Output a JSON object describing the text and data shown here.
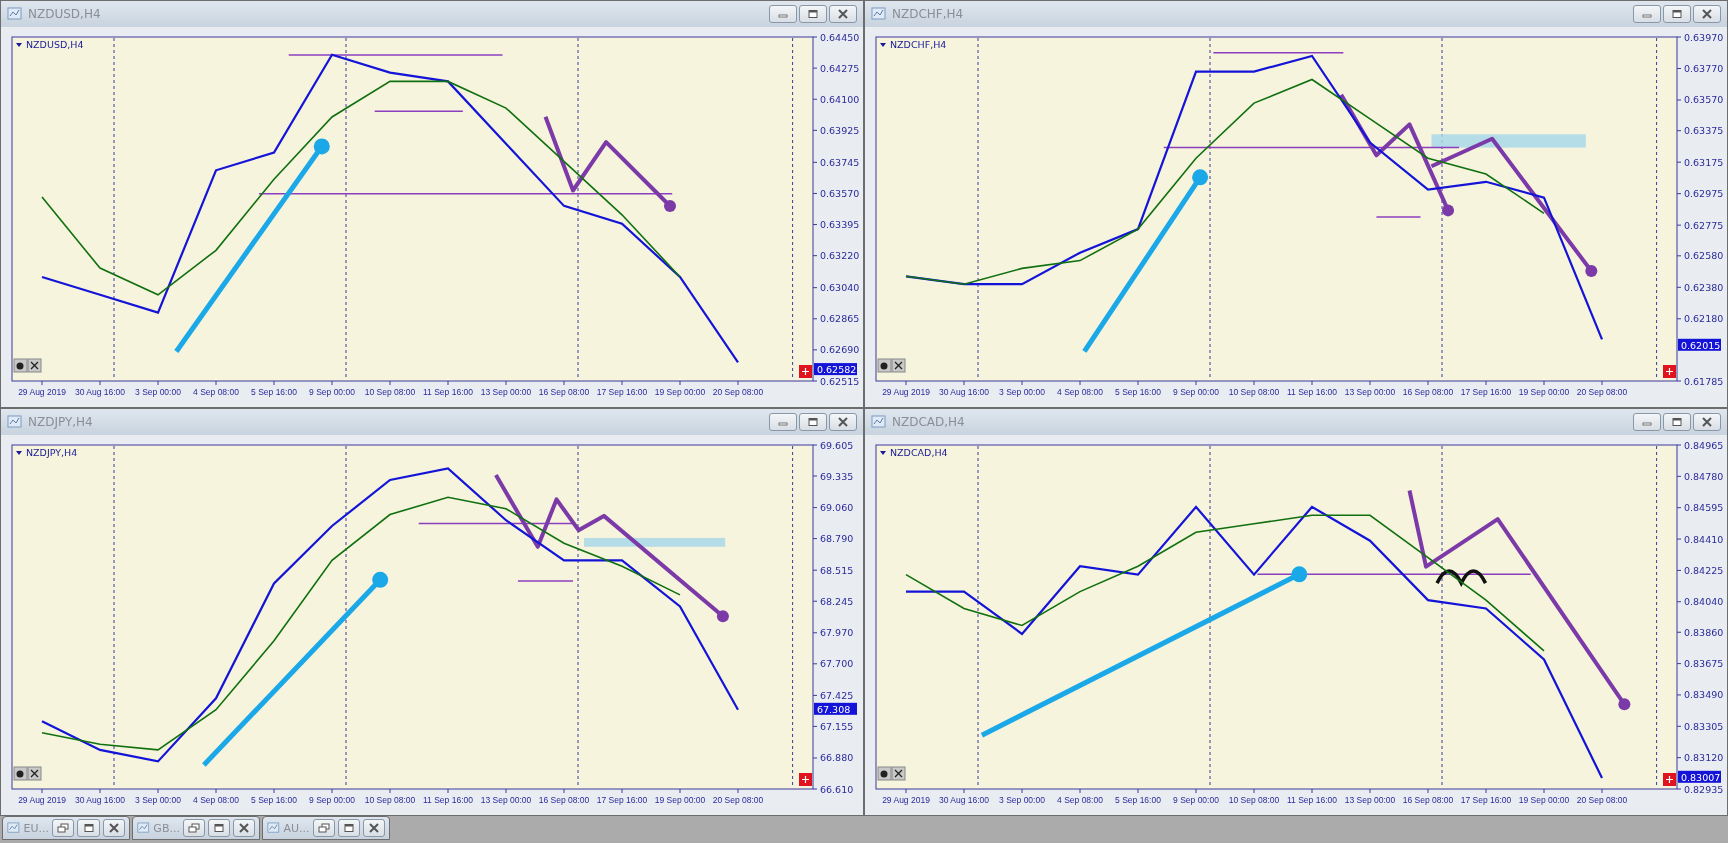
{
  "windows": [
    {
      "title": "NZDUSD,H4",
      "chart": {
        "label": "NZDUSD,H4",
        "current_price": "0.62582",
        "chart_data": {
          "type": "line",
          "categories": [
            "29 Aug 2019",
            "30 Aug 16:00",
            "3 Sep 00:00",
            "4 Sep 08:00",
            "5 Sep 16:00",
            "9 Sep 00:00",
            "10 Sep 08:00",
            "11 Sep 16:00",
            "13 Sep 00:00",
            "16 Sep 08:00",
            "17 Sep 16:00",
            "19 Sep 00:00",
            "20 Sep 08:00"
          ],
          "yticks": [
            {
              "value": 0.6445,
              "label": "0.64450"
            },
            {
              "value": 0.64275,
              "label": "0.64275"
            },
            {
              "value": 0.641,
              "label": "0.64100"
            },
            {
              "value": 0.63925,
              "label": "0.63925"
            },
            {
              "value": 0.63745,
              "label": "0.63745"
            },
            {
              "value": 0.6357,
              "label": "0.63570"
            },
            {
              "value": 0.63395,
              "label": "0.63395"
            },
            {
              "value": 0.6322,
              "label": "0.63220"
            },
            {
              "value": 0.6304,
              "label": "0.63040"
            },
            {
              "value": 0.62865,
              "label": "0.62865"
            },
            {
              "value": 0.6269,
              "label": "0.62690"
            },
            {
              "value": 0.62515,
              "label": "0.62515"
            }
          ],
          "ylim": [
            0.62515,
            0.6445
          ],
          "series": [
            {
              "color": "#1414d8",
              "values": [
                0.631,
                0.63,
                0.629,
                0.637,
                0.638,
                0.6435,
                0.6425,
                0.642,
                0.6385,
                0.635,
                0.634,
                0.631,
                0.6262
              ]
            },
            {
              "color": "#107010",
              "values": [
                0.6355,
                0.6315,
                0.63,
                0.6325,
                0.6365,
                0.64,
                0.642,
                0.642,
                0.6405,
                0.6375,
                0.6345,
                0.631,
                null
              ]
            }
          ]
        }
      }
    },
    {
      "title": "NZDCHF,H4",
      "chart": {
        "label": "NZDCHF,H4",
        "current_price": "0.62015",
        "chart_data": {
          "type": "line",
          "categories": [
            "29 Aug 2019",
            "30 Aug 16:00",
            "3 Sep 00:00",
            "4 Sep 08:00",
            "5 Sep 16:00",
            "9 Sep 00:00",
            "10 Sep 08:00",
            "11 Sep 16:00",
            "13 Sep 00:00",
            "16 Sep 08:00",
            "17 Sep 16:00",
            "19 Sep 00:00",
            "20 Sep 08:00"
          ],
          "yticks": [
            {
              "value": 0.6397,
              "label": "0.63970"
            },
            {
              "value": 0.6377,
              "label": "0.63770"
            },
            {
              "value": 0.6357,
              "label": "0.63570"
            },
            {
              "value": 0.63375,
              "label": "0.63375"
            },
            {
              "value": 0.63175,
              "label": "0.63175"
            },
            {
              "value": 0.62975,
              "label": "0.62975"
            },
            {
              "value": 0.62775,
              "label": "0.62775"
            },
            {
              "value": 0.6258,
              "label": "0.62580"
            },
            {
              "value": 0.6238,
              "label": "0.62380"
            },
            {
              "value": 0.6218,
              "label": "0.62180"
            },
            {
              "value": 0.61785,
              "label": "0.61785"
            }
          ],
          "ylim": [
            0.61785,
            0.6397
          ],
          "series": [
            {
              "color": "#1414d8",
              "values": [
                0.6245,
                0.624,
                0.624,
                0.626,
                0.6275,
                0.6375,
                0.6375,
                0.6385,
                0.633,
                0.63,
                0.6305,
                0.6295,
                0.6205
              ]
            },
            {
              "color": "#107010",
              "values": [
                0.6245,
                0.624,
                0.625,
                0.6255,
                0.6275,
                0.632,
                0.6355,
                0.637,
                0.6345,
                0.632,
                0.631,
                0.6285,
                null
              ]
            }
          ]
        }
      }
    },
    {
      "title": "NZDJPY,H4",
      "chart": {
        "label": "NZDJPY,H4",
        "current_price": "67.308",
        "chart_data": {
          "type": "line",
          "categories": [
            "29 Aug 2019",
            "30 Aug 16:00",
            "3 Sep 00:00",
            "4 Sep 08:00",
            "5 Sep 16:00",
            "9 Sep 00:00",
            "10 Sep 08:00",
            "11 Sep 16:00",
            "13 Sep 00:00",
            "16 Sep 08:00",
            "17 Sep 16:00",
            "19 Sep 00:00",
            "20 Sep 08:00"
          ],
          "yticks": [
            {
              "value": 69.605,
              "label": "69.605"
            },
            {
              "value": 69.335,
              "label": "69.335"
            },
            {
              "value": 69.06,
              "label": "69.060"
            },
            {
              "value": 68.79,
              "label": "68.790"
            },
            {
              "value": 68.515,
              "label": "68.515"
            },
            {
              "value": 68.245,
              "label": "68.245"
            },
            {
              "value": 67.97,
              "label": "67.970"
            },
            {
              "value": 67.7,
              "label": "67.700"
            },
            {
              "value": 67.425,
              "label": "67.425"
            },
            {
              "value": 67.155,
              "label": "67.155"
            },
            {
              "value": 66.88,
              "label": "66.880"
            },
            {
              "value": 66.61,
              "label": "66.610"
            }
          ],
          "ylim": [
            66.61,
            69.605
          ],
          "series": [
            {
              "color": "#1414d8",
              "values": [
                67.2,
                66.95,
                66.85,
                67.4,
                68.4,
                68.9,
                69.3,
                69.4,
                68.95,
                68.6,
                68.6,
                68.2,
                67.3
              ]
            },
            {
              "color": "#107010",
              "values": [
                67.1,
                67.0,
                66.95,
                67.3,
                67.9,
                68.6,
                69.0,
                69.15,
                69.05,
                68.75,
                68.55,
                68.3,
                null
              ]
            }
          ]
        }
      }
    },
    {
      "title": "NZDCAD,H4",
      "chart": {
        "label": "NZDCAD,H4",
        "current_price": "0.83007",
        "chart_data": {
          "type": "line",
          "categories": [
            "29 Aug 2019",
            "30 Aug 16:00",
            "3 Sep 00:00",
            "4 Sep 08:00",
            "5 Sep 16:00",
            "9 Sep 00:00",
            "10 Sep 08:00",
            "11 Sep 16:00",
            "13 Sep 00:00",
            "16 Sep 08:00",
            "17 Sep 16:00",
            "19 Sep 00:00",
            "20 Sep 08:00"
          ],
          "yticks": [
            {
              "value": 0.84965,
              "label": "0.84965"
            },
            {
              "value": 0.8478,
              "label": "0.84780"
            },
            {
              "value": 0.84595,
              "label": "0.84595"
            },
            {
              "value": 0.8441,
              "label": "0.84410"
            },
            {
              "value": 0.84225,
              "label": "0.84225"
            },
            {
              "value": 0.8404,
              "label": "0.84040"
            },
            {
              "value": 0.8386,
              "label": "0.83860"
            },
            {
              "value": 0.83675,
              "label": "0.83675"
            },
            {
              "value": 0.8349,
              "label": "0.83490"
            },
            {
              "value": 0.83305,
              "label": "0.83305"
            },
            {
              "value": 0.8312,
              "label": "0.83120"
            },
            {
              "value": 0.82935,
              "label": "0.82935"
            }
          ],
          "ylim": [
            0.82935,
            0.84965
          ],
          "series": [
            {
              "color": "#1414d8",
              "values": [
                0.841,
                0.841,
                0.8385,
                0.8425,
                0.842,
                0.846,
                0.842,
                0.846,
                0.844,
                0.8405,
                0.84,
                0.837,
                0.83
              ]
            },
            {
              "color": "#107010",
              "values": [
                0.842,
                0.84,
                0.839,
                0.841,
                0.8425,
                0.8445,
                0.845,
                0.8455,
                0.8455,
                0.843,
                0.8405,
                0.8375,
                null
              ]
            }
          ]
        }
      }
    }
  ],
  "minimized_windows": [
    {
      "title": "EU..."
    },
    {
      "title": "GB..."
    },
    {
      "title": "AU..."
    }
  ]
}
